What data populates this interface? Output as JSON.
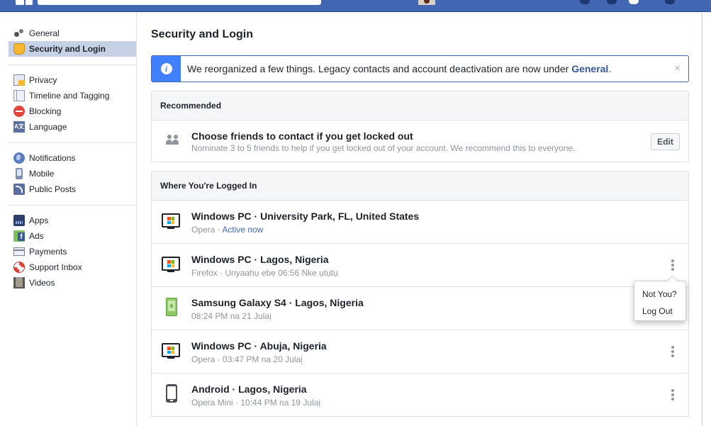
{
  "topbar": {
    "brand_color": "#4267b2"
  },
  "sidebar": {
    "groups": [
      [
        {
          "label": "General",
          "icon": "gears-icon"
        },
        {
          "label": "Security and Login",
          "icon": "badge-icon",
          "active": true
        }
      ],
      [
        {
          "label": "Privacy",
          "icon": "lock-icon"
        },
        {
          "label": "Timeline and Tagging",
          "icon": "timeline-icon"
        },
        {
          "label": "Blocking",
          "icon": "block-icon"
        },
        {
          "label": "Language",
          "icon": "language-icon"
        }
      ],
      [
        {
          "label": "Notifications",
          "icon": "globe-icon"
        },
        {
          "label": "Mobile",
          "icon": "mobile-icon"
        },
        {
          "label": "Public Posts",
          "icon": "rss-icon"
        }
      ],
      [
        {
          "label": "Apps",
          "icon": "apps-icon"
        },
        {
          "label": "Ads",
          "icon": "ads-icon"
        },
        {
          "label": "Payments",
          "icon": "payments-icon"
        },
        {
          "label": "Support Inbox",
          "icon": "lifebuoy-icon"
        },
        {
          "label": "Videos",
          "icon": "film-icon"
        }
      ]
    ]
  },
  "main": {
    "title": "Security and Login",
    "notice": {
      "text": "We reorganized a few things. Legacy contacts and account deactivation are now under ",
      "link": "General",
      "suffix": ".",
      "close": "×",
      "info_glyph": "i"
    },
    "recommended": {
      "header": "Recommended",
      "title": "Choose friends to contact if you get locked out",
      "subtitle": "Nominate 3 to 5 friends to help if you get locked out of your account. We recommend this to everyone.",
      "button": "Edit"
    },
    "sessions": {
      "header": "Where You're Logged In",
      "items": [
        {
          "device": "Windows PC · University Park, FL, United States",
          "browser": "Opera",
          "time": "Active now",
          "active": true,
          "icon": "windows-pc-icon"
        },
        {
          "device": "Windows PC · Lagos, Nigeria",
          "browser": "Firefox",
          "time": "Ụnyaahụ ebe 06:56 Nke ụtụtụ",
          "icon": "windows-pc-icon"
        },
        {
          "device": "Samsung Galaxy S4 · Lagos, Nigeria",
          "browser": "",
          "time": "08:24 PM na 21 Julaị",
          "icon": "samsung-phone-icon"
        },
        {
          "device": "Windows PC · Abuja, Nigeria",
          "browser": "Opera",
          "time": "03:47 PM na 20 Julaị",
          "icon": "windows-pc-icon"
        },
        {
          "device": "Android · Lagos, Nigeria",
          "browser": "Opera Mini",
          "time": "10:44 PM na 19 Julaị",
          "icon": "android-phone-icon"
        }
      ],
      "separator": " · "
    },
    "session_menu": {
      "items": [
        "Not You?",
        "Log Out"
      ]
    }
  }
}
